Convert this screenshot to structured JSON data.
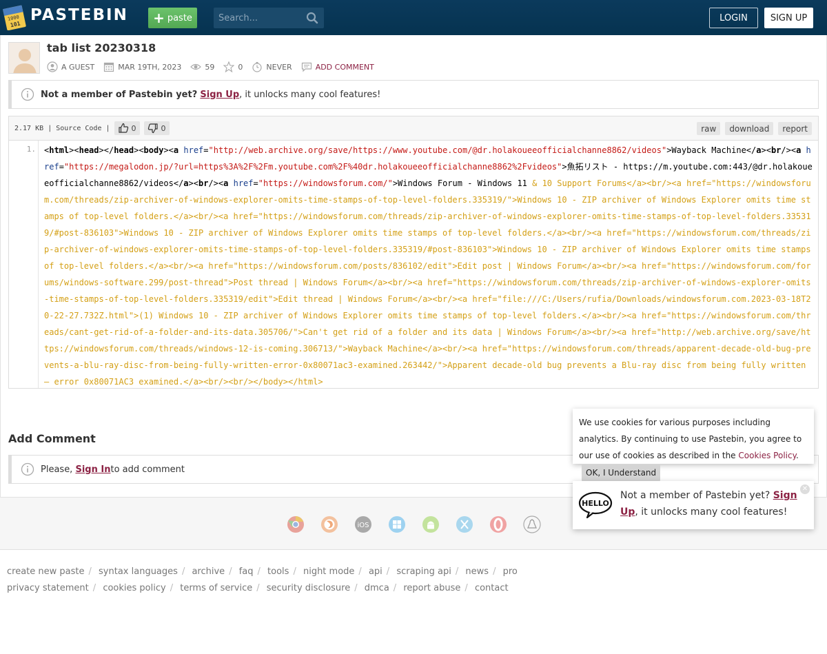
{
  "header": {
    "logo": "PASTEBIN",
    "paste_label": "paste",
    "search_placeholder": "Search...",
    "login_label": "LOGIN",
    "signup_label": "SIGN UP"
  },
  "paste": {
    "title": "tab list 20230318",
    "author": "A GUEST",
    "date": "MAR 19TH, 2023",
    "views": "59",
    "stars": "0",
    "expiry": "NEVER",
    "add_comment": "ADD COMMENT"
  },
  "notice": {
    "prefix": "Not a member of Pastebin yet?",
    "link": "Sign Up",
    "suffix": ", it unlocks many cool features!"
  },
  "code_header": {
    "size": "2.17 KB",
    "sep1": "|",
    "type": "Source Code",
    "sep2": "|",
    "likes": "0",
    "dislikes": "0",
    "raw": "raw",
    "download": "download",
    "report": "report"
  },
  "code": {
    "line_number": "1.",
    "part1_text": "Wayback Machine",
    "part2_text": "魚拓リスト - https://m.youtube.com:443/@dr.holakoueeofficialchanne8862/videos",
    "part3_text": "Windows Forum - Windows 11 ",
    "url1": "\"http://web.archive.org/save/https://www.youtube.com/@dr.holakoueeofficialchanne8862/videos\"",
    "url2": "\"https://megalodon.jp/?url=https%3A%2F%2Fm.youtube.com%2F%40dr.holakoueeofficialchanne8862%2Fvideos\"",
    "url3": "\"https://windowsforum.com/\"",
    "rest": "& 10 Support Forums</a><br/><a href=\"https://windowsforum.com/threads/zip-archiver-of-windows-explorer-omits-time-stamps-of-top-level-folders.335319/\">Windows 10 - ZIP archiver of Windows Explorer omits time stamps of top-level folders.</a><br/><a href=\"https://windowsforum.com/threads/zip-archiver-of-windows-explorer-omits-time-stamps-of-top-level-folders.335319/#post-836103\">Windows 10 - ZIP archiver of Windows Explorer omits time stamps of top-level folders.</a><br/><a href=\"https://windowsforum.com/threads/zip-archiver-of-windows-explorer-omits-time-stamps-of-top-level-folders.335319/#post-836103\">Windows 10 - ZIP archiver of Windows Explorer omits time stamps of top-level folders.</a><br/><a href=\"https://windowsforum.com/posts/836102/edit\">Edit post | Windows Forum</a><br/><a href=\"https://windowsforum.com/forums/windows-software.299/post-thread\">Post thread | Windows Forum</a><br/><a href=\"https://windowsforum.com/threads/zip-archiver-of-windows-explorer-omits-time-stamps-of-top-level-folders.335319/edit\">Edit thread | Windows Forum</a><br/><a href=\"file:///C:/Users/rufia/Downloads/windowsforum.com.2023-03-18T20-22-27.732Z.html\">(1) Windows 10 - ZIP archiver of Windows Explorer omits time stamps of top-level folders.</a><br/><a href=\"https://windowsforum.com/threads/cant-get-rid-of-a-folder-and-its-data.305706/\">Can't get rid of a folder and its data | Windows Forum</a><br/><a href=\"http://web.archive.org/save/https://windowsforum.com/threads/windows-12-is-coming.306713/\">Wayback Machine</a><br/><a href=\"https://windowsforum.com/threads/apparent-decade-old-bug-prevents-a-blu-ray-disc-from-being-fully-written-error-0x80071ac3-examined.263442/\">Apparent decade-old bug prevents a Blu-ray disc from being fully written – error 0x80071AC3 examined.</a><br/><br/></body></html>"
  },
  "comments": {
    "title": "Add Comment",
    "prefix": "Please, ",
    "link": "Sign In",
    "suffix": " to add comment"
  },
  "footer": {
    "row1": [
      "create new paste",
      "syntax languages",
      "archive",
      "faq",
      "tools",
      "night mode",
      "api",
      "scraping api",
      "news",
      "pro"
    ],
    "row2": [
      "privacy statement",
      "cookies policy",
      "terms of service",
      "security disclosure",
      "dmca",
      "report abuse",
      "contact"
    ]
  },
  "cookie": {
    "text": "We use cookies for various purposes including analytics. By continuing to use Pastebin, you agree to our use of cookies as described in the ",
    "link": "Cookies Policy",
    "end": ".",
    "ok": "OK, I Understand"
  },
  "member_popup": {
    "prefix": "Not a member of Pastebin yet?",
    "link": "Sign Up",
    "suffix": ", it unlocks many cool features!",
    "hello": "HELLO"
  },
  "colors": {
    "header_bg": "#063350",
    "accent": "#8c2244",
    "paste_green": "#5bb75b",
    "code_orange": "#d4a017"
  }
}
